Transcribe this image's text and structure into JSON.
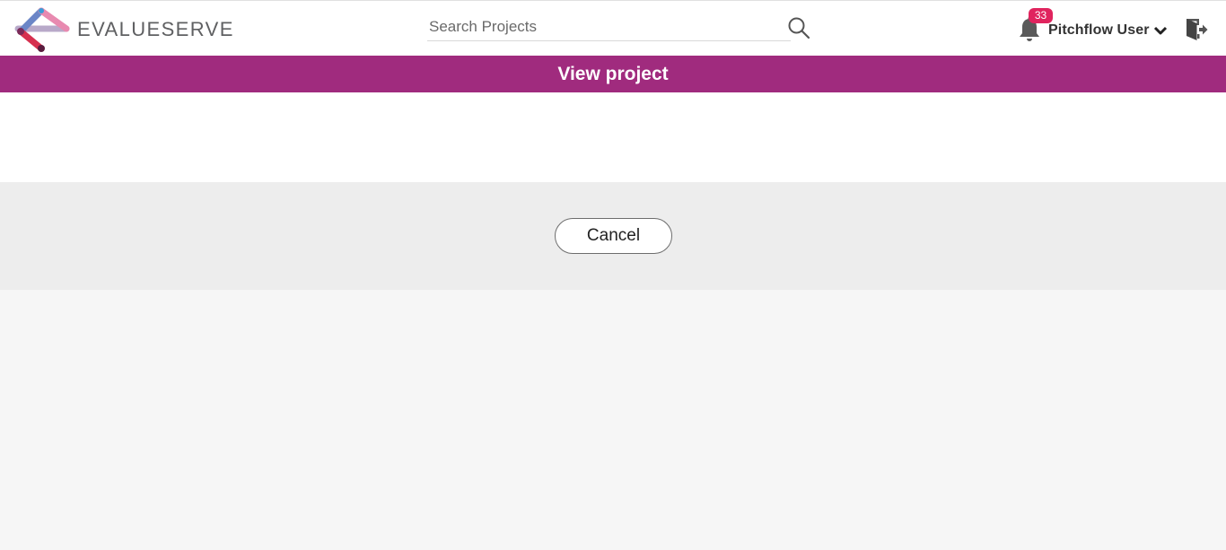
{
  "brand": {
    "name": "EVALUESERVE",
    "colors": {
      "primary": "#a02b7e",
      "badge": "#e0245e",
      "logo_grey": "#5f6062"
    }
  },
  "header": {
    "search": {
      "placeholder": "Search Projects",
      "value": "",
      "icon": "search-icon"
    },
    "notifications": {
      "icon": "bell-icon",
      "count": "33"
    },
    "user": {
      "name": "Pitchflow User",
      "icon": "chevron-down-icon"
    },
    "logout": {
      "icon": "logout-icon"
    }
  },
  "page": {
    "title": "View project"
  },
  "actions": {
    "cancel_label": "Cancel"
  }
}
